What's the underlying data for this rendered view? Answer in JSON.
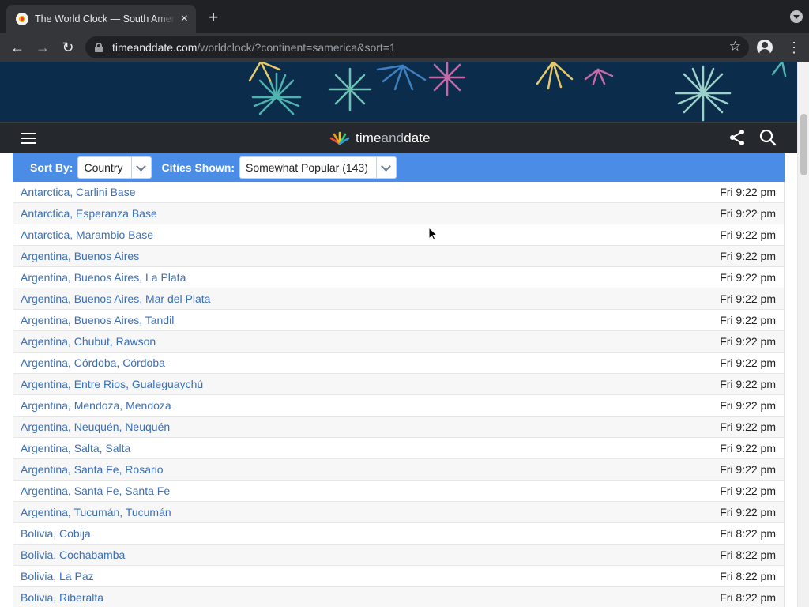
{
  "browser": {
    "tab_title": "The World Clock — South America",
    "tab_close": "×",
    "new_tab": "+",
    "url_host": "timeanddate.com",
    "url_path": "/worldclock/?continent=samerica&sort=1",
    "back": "←",
    "forward": "→",
    "reload": "↻",
    "star": "☆",
    "menu": "⋮"
  },
  "site": {
    "logo_text_a": "time",
    "logo_text_b": "and",
    "logo_text_c": "date"
  },
  "filters": {
    "sort_label": "Sort By:",
    "sort_value": "Country",
    "cities_label": "Cities Shown:",
    "cities_value": "Somewhat Popular (143)"
  },
  "cities": [
    {
      "name": "Antarctica, Carlini Base",
      "time": "Fri 9:22 pm"
    },
    {
      "name": "Antarctica, Esperanza Base",
      "time": "Fri 9:22 pm"
    },
    {
      "name": "Antarctica, Marambio Base",
      "time": "Fri 9:22 pm"
    },
    {
      "name": "Argentina, Buenos Aires",
      "time": "Fri 9:22 pm"
    },
    {
      "name": "Argentina, Buenos Aires, La Plata",
      "time": "Fri 9:22 pm"
    },
    {
      "name": "Argentina, Buenos Aires, Mar del Plata",
      "time": "Fri 9:22 pm"
    },
    {
      "name": "Argentina, Buenos Aires, Tandil",
      "time": "Fri 9:22 pm"
    },
    {
      "name": "Argentina, Chubut, Rawson",
      "time": "Fri 9:22 pm"
    },
    {
      "name": "Argentina, Córdoba, Córdoba",
      "time": "Fri 9:22 pm"
    },
    {
      "name": "Argentina, Entre Rios, Gualeguaychú",
      "time": "Fri 9:22 pm"
    },
    {
      "name": "Argentina, Mendoza, Mendoza",
      "time": "Fri 9:22 pm"
    },
    {
      "name": "Argentina, Neuquén, Neuquén",
      "time": "Fri 9:22 pm"
    },
    {
      "name": "Argentina, Salta, Salta",
      "time": "Fri 9:22 pm"
    },
    {
      "name": "Argentina, Santa Fe, Rosario",
      "time": "Fri 9:22 pm"
    },
    {
      "name": "Argentina, Santa Fe, Santa Fe",
      "time": "Fri 9:22 pm"
    },
    {
      "name": "Argentina, Tucumán, Tucumán",
      "time": "Fri 9:22 pm"
    },
    {
      "name": "Bolivia, Cobija",
      "time": "Fri 8:22 pm"
    },
    {
      "name": "Bolivia, Cochabamba",
      "time": "Fri 8:22 pm"
    },
    {
      "name": "Bolivia, La Paz",
      "time": "Fri 8:22 pm"
    },
    {
      "name": "Bolivia, Riberalta",
      "time": "Fri 8:22 pm"
    }
  ]
}
